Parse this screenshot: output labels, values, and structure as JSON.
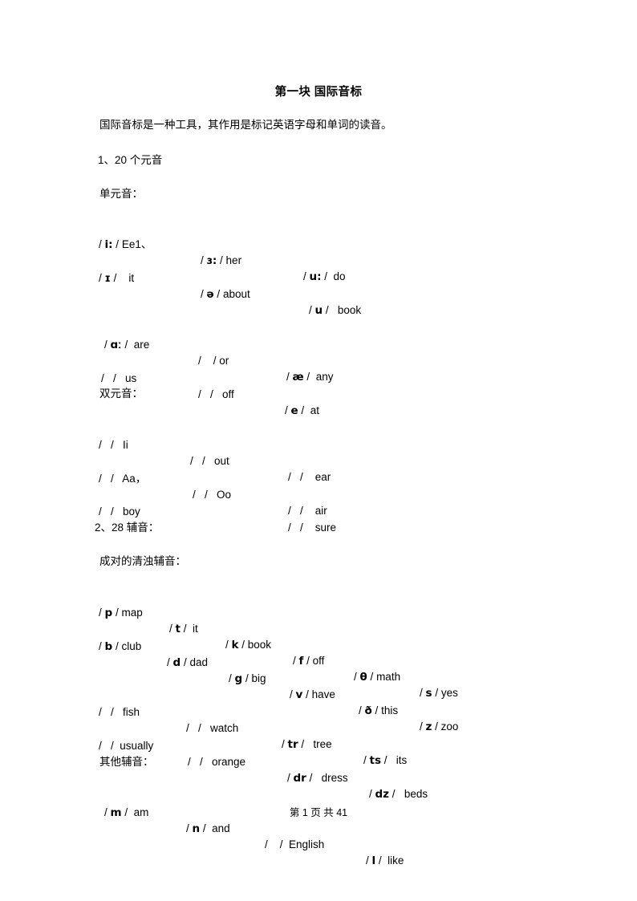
{
  "document": {
    "title": "第一块 国际音标",
    "intro": "国际音标是一种工具，其作用是标记英语字母和单词的读音。"
  },
  "sections": {
    "vowels_heading": "1、20 个元音",
    "monophthong_heading": "单元音：",
    "diphthong_heading": "双元音：",
    "consonants_heading": "2、28 辅音：",
    "paired_heading": "成对的清浊辅音：",
    "other_heading": "其他辅音："
  },
  "monophthongs": {
    "row1": [
      {
        "symbol": "i:",
        "word": "Ee1、"
      },
      {
        "symbol": "ɜ:",
        "word": "her"
      },
      {
        "symbol": "u:",
        "word": "do"
      }
    ],
    "row2": [
      {
        "symbol": "ɪ",
        "word": "it"
      },
      {
        "symbol": "ə",
        "word": "about"
      },
      {
        "symbol": "u",
        "word": "book"
      }
    ],
    "row3": [
      {
        "symbol": "ɑː",
        "word": "are"
      },
      {
        "symbol": "",
        "word": "or"
      },
      {
        "symbol": "æ",
        "word": "any"
      }
    ],
    "row4": [
      {
        "symbol": "",
        "word": "us"
      },
      {
        "symbol": "",
        "word": "off"
      },
      {
        "symbol": "e",
        "word": "at"
      }
    ]
  },
  "diphthongs": {
    "row1": [
      {
        "symbol": "",
        "word": "Ii"
      },
      {
        "symbol": "",
        "word": "out"
      },
      {
        "symbol": "",
        "word": "ear"
      }
    ],
    "row2": [
      {
        "symbol": "",
        "word": "Aa，"
      },
      {
        "symbol": "",
        "word": "Oo"
      },
      {
        "symbol": "",
        "word": "air"
      }
    ],
    "row3": [
      {
        "symbol": "",
        "word": "boy"
      },
      {
        "symbol": "",
        "word": "sure"
      }
    ]
  },
  "consonants": {
    "voiceless": [
      {
        "symbol": "p",
        "word": "map"
      },
      {
        "symbol": "t",
        "word": "it"
      },
      {
        "symbol": "k",
        "word": "book"
      },
      {
        "symbol": "f",
        "word": "off"
      },
      {
        "symbol": "θ",
        "word": "math"
      },
      {
        "symbol": "s",
        "word": "yes"
      }
    ],
    "voiced": [
      {
        "symbol": "b",
        "word": "club"
      },
      {
        "symbol": "d",
        "word": "dad"
      },
      {
        "symbol": "g",
        "word": "big"
      },
      {
        "symbol": "v",
        "word": "have"
      },
      {
        "symbol": "ð",
        "word": "this"
      },
      {
        "symbol": "z",
        "word": "zoo"
      }
    ],
    "voiceless2": [
      {
        "symbol": "",
        "word": "fish"
      },
      {
        "symbol": "",
        "word": "watch"
      },
      {
        "symbol": "tr",
        "word": "tree"
      },
      {
        "symbol": "ts",
        "word": "its"
      }
    ],
    "voiced2": [
      {
        "symbol": "",
        "word": "usually"
      },
      {
        "symbol": "",
        "word": "orange"
      },
      {
        "symbol": "dr",
        "word": "dress"
      },
      {
        "symbol": "dz",
        "word": "beds"
      }
    ],
    "other": [
      {
        "symbol": "m",
        "word": "am"
      },
      {
        "symbol": "n",
        "word": "and"
      },
      {
        "symbol": "",
        "word": "English"
      },
      {
        "symbol": "l",
        "word": "like"
      }
    ]
  },
  "footer": {
    "text": "第 1 页 共 41",
    "page_number": "1",
    "total_pages": "41"
  }
}
